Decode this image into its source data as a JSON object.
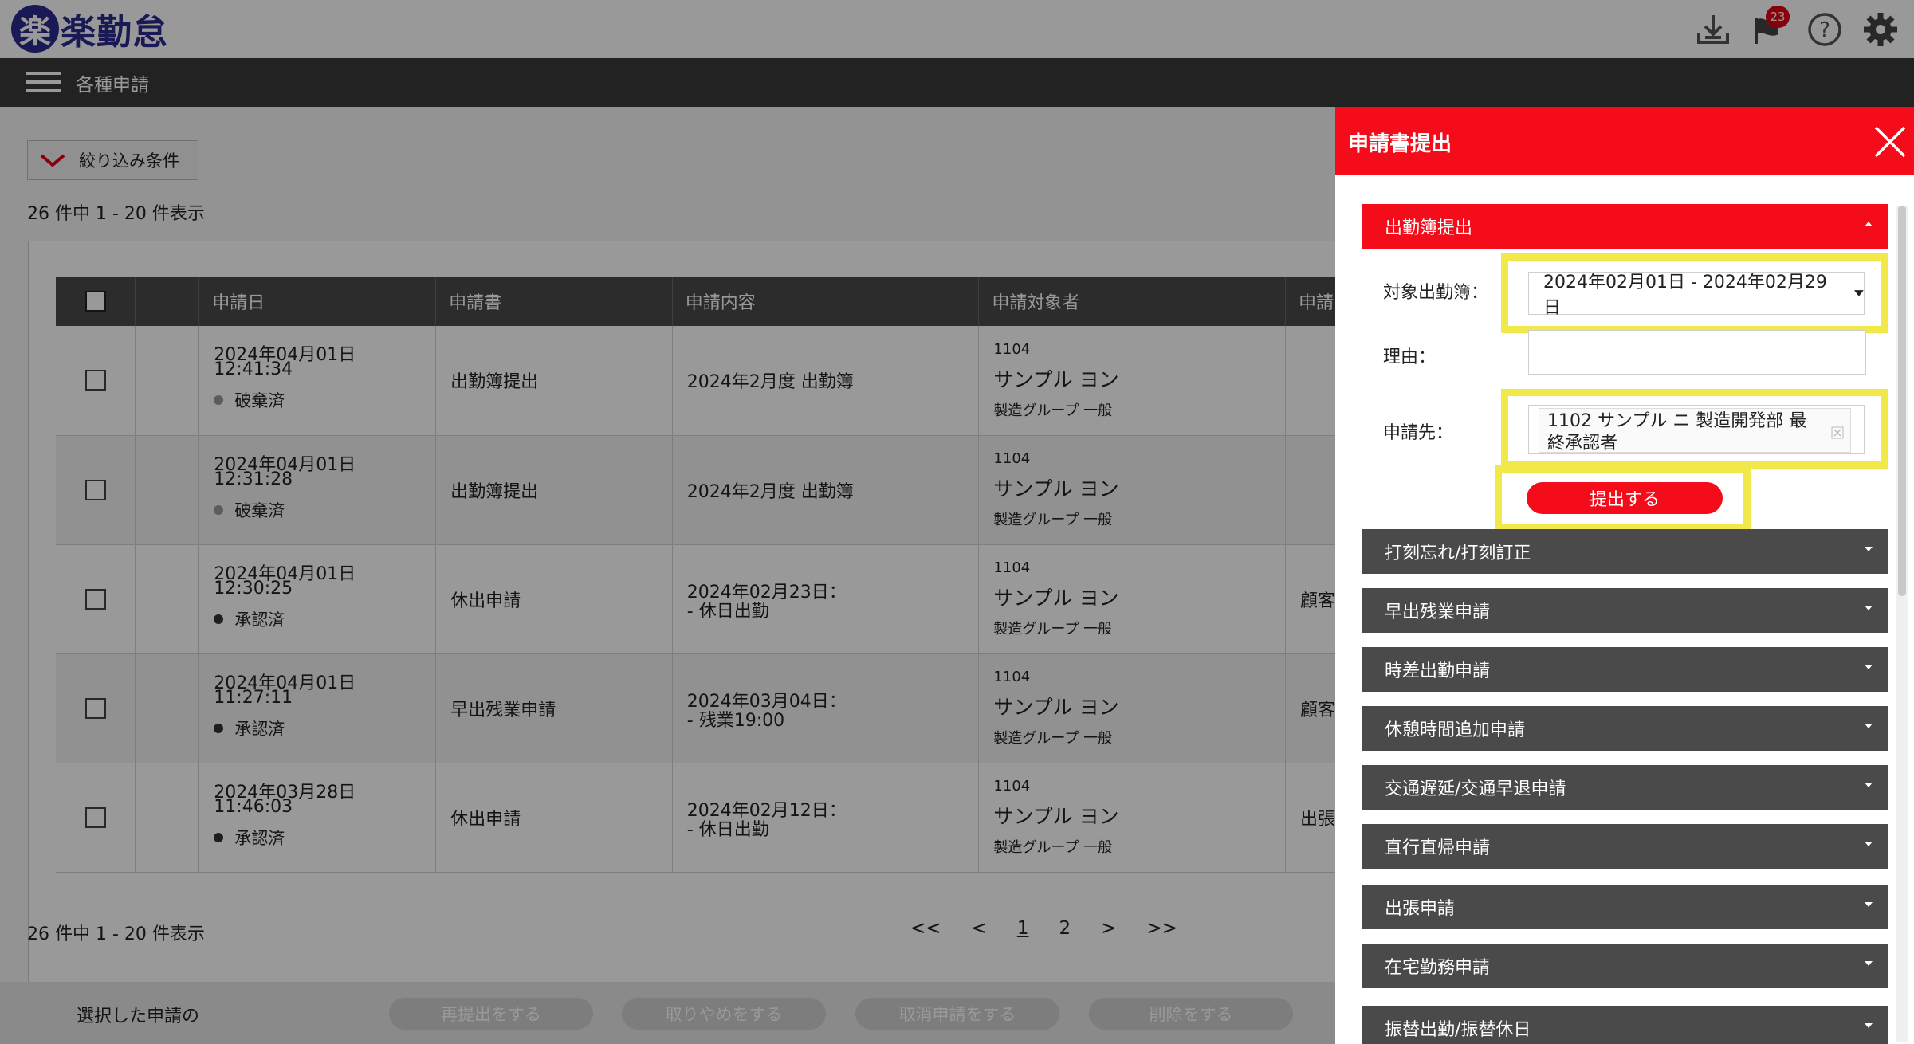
{
  "app": {
    "logo_mark": "楽",
    "logo_text": "楽勤怠",
    "notification_count": "23"
  },
  "menu": {
    "title": "各種申請"
  },
  "filter": {
    "label": "絞り込み条件"
  },
  "count_text": "26 件中 1 - 20 件表示",
  "table": {
    "headers": [
      "申請日",
      "申請書",
      "申請内容",
      "申請対象者",
      "申請"
    ],
    "rows": [
      {
        "date": "2024年04月01日",
        "time": "12:41:34",
        "status": "破棄済",
        "form": "出勤簿提出",
        "content1": "2024年2月度 出勤簿",
        "content2": "",
        "code": "1104",
        "name": "サンプル ヨン",
        "dept": "製造グループ 一般",
        "extra": ""
      },
      {
        "date": "2024年04月01日",
        "time": "12:31:28",
        "status": "破棄済",
        "form": "出勤簿提出",
        "content1": "2024年2月度 出勤簿",
        "content2": "",
        "code": "1104",
        "name": "サンプル ヨン",
        "dept": "製造グループ 一般",
        "extra": ""
      },
      {
        "date": "2024年04月01日",
        "time": "12:30:25",
        "status": "承認済",
        "form": "休出申請",
        "content1": "2024年02月23日：",
        "content2": "- 休日出勤",
        "code": "1104",
        "name": "サンプル ヨン",
        "dept": "製造グループ 一般",
        "extra": "顧客"
      },
      {
        "date": "2024年04月01日",
        "time": "11:27:11",
        "status": "承認済",
        "form": "早出残業申請",
        "content1": "2024年03月04日：",
        "content2": "- 残業19:00",
        "code": "1104",
        "name": "サンプル ヨン",
        "dept": "製造グループ 一般",
        "extra": "顧客"
      },
      {
        "date": "2024年03月28日",
        "time": "11:46:03",
        "status": "承認済",
        "form": "休出申請",
        "content1": "2024年02月12日：",
        "content2": "- 休日出勤",
        "code": "1104",
        "name": "サンプル ヨン",
        "dept": "製造グループ 一般",
        "extra": "出張"
      }
    ]
  },
  "pager": {
    "first": "<<",
    "prev": "<",
    "page1": "1",
    "page2": "2",
    "next": ">",
    "last": ">>"
  },
  "bottom": {
    "label": "選択した申請の",
    "buttons": [
      "再提出をする",
      "取りやめをする",
      "取消申請をする",
      "削除をする"
    ]
  },
  "panel": {
    "title": "申請書提出",
    "open_section": "出勤簿提出",
    "target_label": "対象出勤簿：",
    "target_value": "2024年02月01日 - 2024年02月29日",
    "reason_label": "理由：",
    "reason_value": "",
    "approver_label": "申請先：",
    "approver_value_line1": "1102 サンプル ニ 製造開発部 最",
    "approver_value_line2": "終承認者",
    "submit_label": "提出する",
    "sections": [
      "打刻忘れ/打刻訂正",
      "早出残業申請",
      "時差出勤申請",
      "休憩時間追加申請",
      "交通遅延/交通早退申請",
      "直行直帰申請",
      "出張申請",
      "在宅勤務申請",
      "振替出勤/振替休日"
    ]
  },
  "colors": {
    "brand": "#2b2b8f",
    "accent": "#f50c1a",
    "highlight": "#f1e94a"
  }
}
